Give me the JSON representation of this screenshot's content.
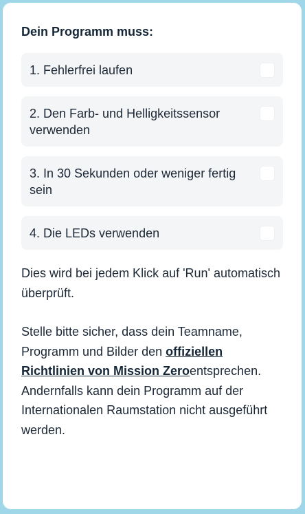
{
  "heading": "Dein Programm muss:",
  "requirements": [
    {
      "label": "1. Fehlerfrei laufen",
      "checked": false
    },
    {
      "label": "2. Den Farb- und Helligkeitssensor verwenden",
      "checked": false
    },
    {
      "label": "3. In 30 Sekunden oder weniger fertig sein",
      "checked": false
    },
    {
      "label": "4. Die LEDs verwenden",
      "checked": false
    }
  ],
  "auto_check_text": "Dies wird bei jedem Klick auf 'Run' automatisch überprüft.",
  "guidelines": {
    "before_link": "Stelle bitte sicher, dass dein Teamname, Programm und Bilder den ",
    "link_text": "offiziellen Richtlinien von Mission Zero",
    "after_link": "entsprechen. Andernfalls kann dein Programm auf der Internationalen Raumstation nicht ausgeführt werden."
  }
}
